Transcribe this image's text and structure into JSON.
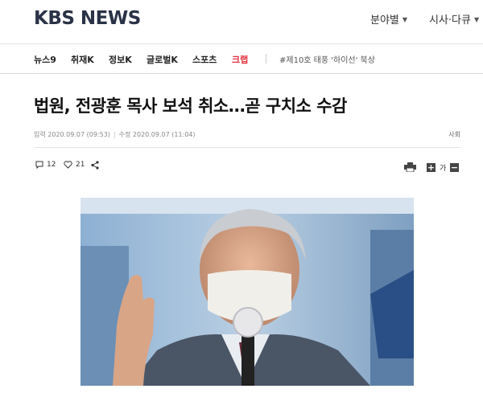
{
  "brand": {
    "logo_text": "KBS NEWS"
  },
  "header": {
    "menus": [
      {
        "label": "분야별"
      },
      {
        "label": "시사·다큐"
      }
    ]
  },
  "nav": {
    "items": [
      {
        "label": "뉴스9"
      },
      {
        "label": "취재K"
      },
      {
        "label": "정보K"
      },
      {
        "label": "글로벌K"
      },
      {
        "label": "스포츠"
      },
      {
        "label": "크랩"
      }
    ],
    "hot_topic": "#제10호 태풍 '하이선' 북상"
  },
  "article": {
    "headline": "법원, 전광훈 목사 보석 취소…곧 구치소 수감",
    "published": "입력 2020.09.07 (09:53)",
    "modified": "수정 2020.09.07 (11:04)",
    "section": "사회",
    "comment_count": "12",
    "like_count": "21",
    "font_size_label": "가"
  },
  "colors": {
    "brand": "#2a3247",
    "accent_red": "#e5303b"
  },
  "icons": [
    "chevron-down-icon",
    "comment-icon",
    "heart-icon",
    "share-icon",
    "print-icon",
    "plus-icon",
    "minus-icon"
  ]
}
